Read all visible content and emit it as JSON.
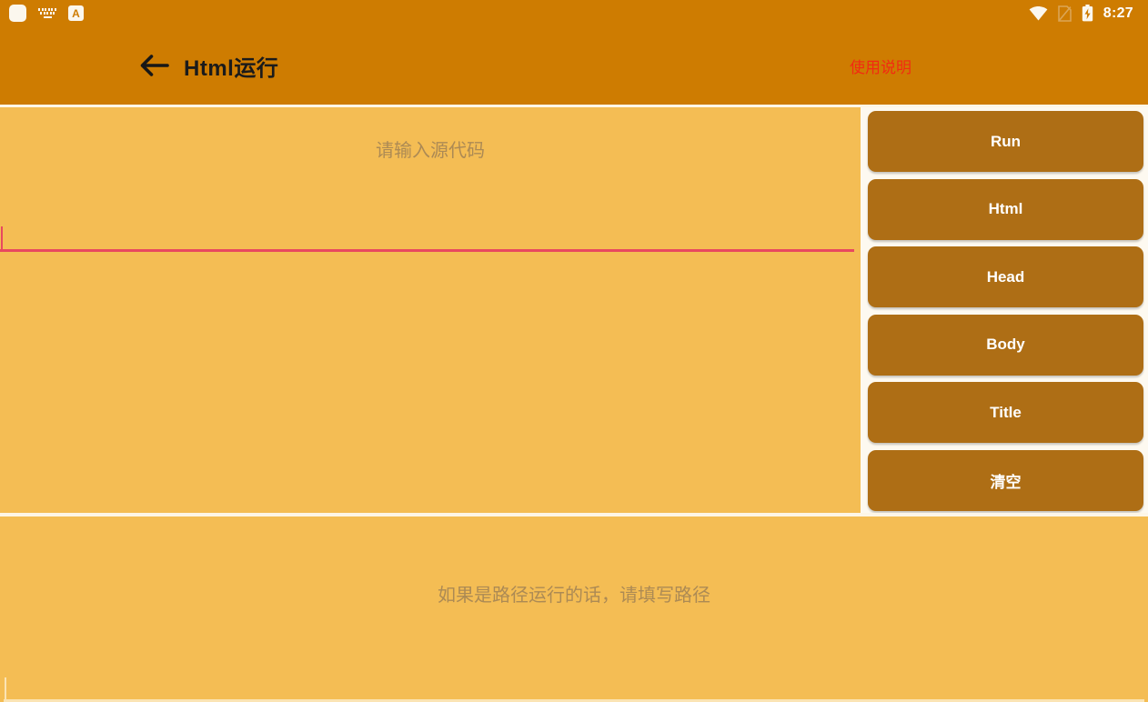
{
  "statusbar": {
    "time": "8:27",
    "icons_left": [
      "app-square-icon",
      "keyboard-icon",
      "input-method-a-icon"
    ],
    "icons_right": [
      "wifi-icon",
      "sim-card-icon",
      "battery-charging-icon"
    ],
    "letter_icon": "A",
    "bg_color": "#CE7C01"
  },
  "appbar": {
    "back_icon": "back-arrow-icon",
    "title": "Html运行",
    "help_label": "使用说明",
    "help_color": "#F22A12",
    "bg_color": "#CE7C01",
    "title_color": "#1B1B1B"
  },
  "editor": {
    "placeholder": "请输入源代码",
    "value": "",
    "underline_color": "#E8485F"
  },
  "buttons": [
    {
      "label": "Run",
      "name": "run-button"
    },
    {
      "label": "Html",
      "name": "html-button"
    },
    {
      "label": "Head",
      "name": "head-button"
    },
    {
      "label": "Body",
      "name": "body-button"
    },
    {
      "label": "Title",
      "name": "title-button"
    },
    {
      "label": "清空",
      "name": "clear-button"
    }
  ],
  "path_field": {
    "placeholder": "如果是路径运行的话，请填写路径",
    "value": "",
    "underline_color": "#FBE4B4"
  },
  "theme": {
    "page_bg": "#F4BD54",
    "button_bg": "#AE6E15",
    "divider": "#FDF6E7",
    "placeholder_text": "#AC8A54"
  }
}
